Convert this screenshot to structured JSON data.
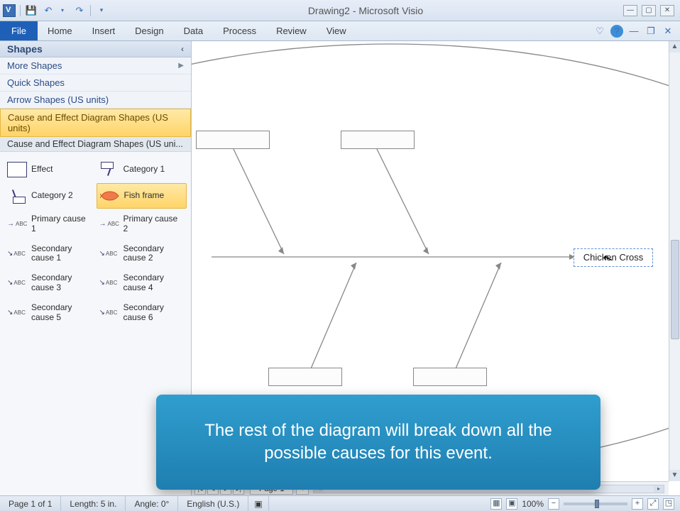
{
  "titlebar": {
    "title": "Drawing2 - Microsoft Visio"
  },
  "ribbon": {
    "file": "File",
    "tabs": [
      "Home",
      "Insert",
      "Design",
      "Data",
      "Process",
      "Review",
      "View"
    ]
  },
  "shapes_panel": {
    "title": "Shapes",
    "more_shapes": "More Shapes",
    "stencils": [
      {
        "label": "Quick Shapes",
        "active": false
      },
      {
        "label": "Arrow Shapes (US units)",
        "active": false
      },
      {
        "label": "Cause and Effect Diagram Shapes (US units)",
        "active": true
      }
    ],
    "sub_header": "Cause and Effect Diagram Shapes (US uni...",
    "shapes": [
      {
        "label": "Effect",
        "icon": "effect"
      },
      {
        "label": "Category 1",
        "icon": "cat1"
      },
      {
        "label": "Category 2",
        "icon": "cat2"
      },
      {
        "label": "Fish frame",
        "icon": "fish",
        "selected": true
      },
      {
        "label": "Primary cause 1",
        "icon": "prim"
      },
      {
        "label": "Primary cause 2",
        "icon": "prim"
      },
      {
        "label": "Secondary cause 1",
        "icon": "sec"
      },
      {
        "label": "Secondary cause 2",
        "icon": "sec"
      },
      {
        "label": "Secondary cause 3",
        "icon": "sec"
      },
      {
        "label": "Secondary cause 4",
        "icon": "sec"
      },
      {
        "label": "Secondary cause 5",
        "icon": "sec"
      },
      {
        "label": "Secondary cause 6",
        "icon": "sec"
      }
    ]
  },
  "canvas": {
    "effect_text": "Chicken Cross",
    "page_tab": "Page-1"
  },
  "callout": {
    "text": "The rest of the diagram will break down all the possible causes for this event."
  },
  "statusbar": {
    "page": "Page 1 of 1",
    "length": "Length: 5 in.",
    "angle": "Angle: 0°",
    "lang": "English (U.S.)",
    "zoom": "100%"
  }
}
